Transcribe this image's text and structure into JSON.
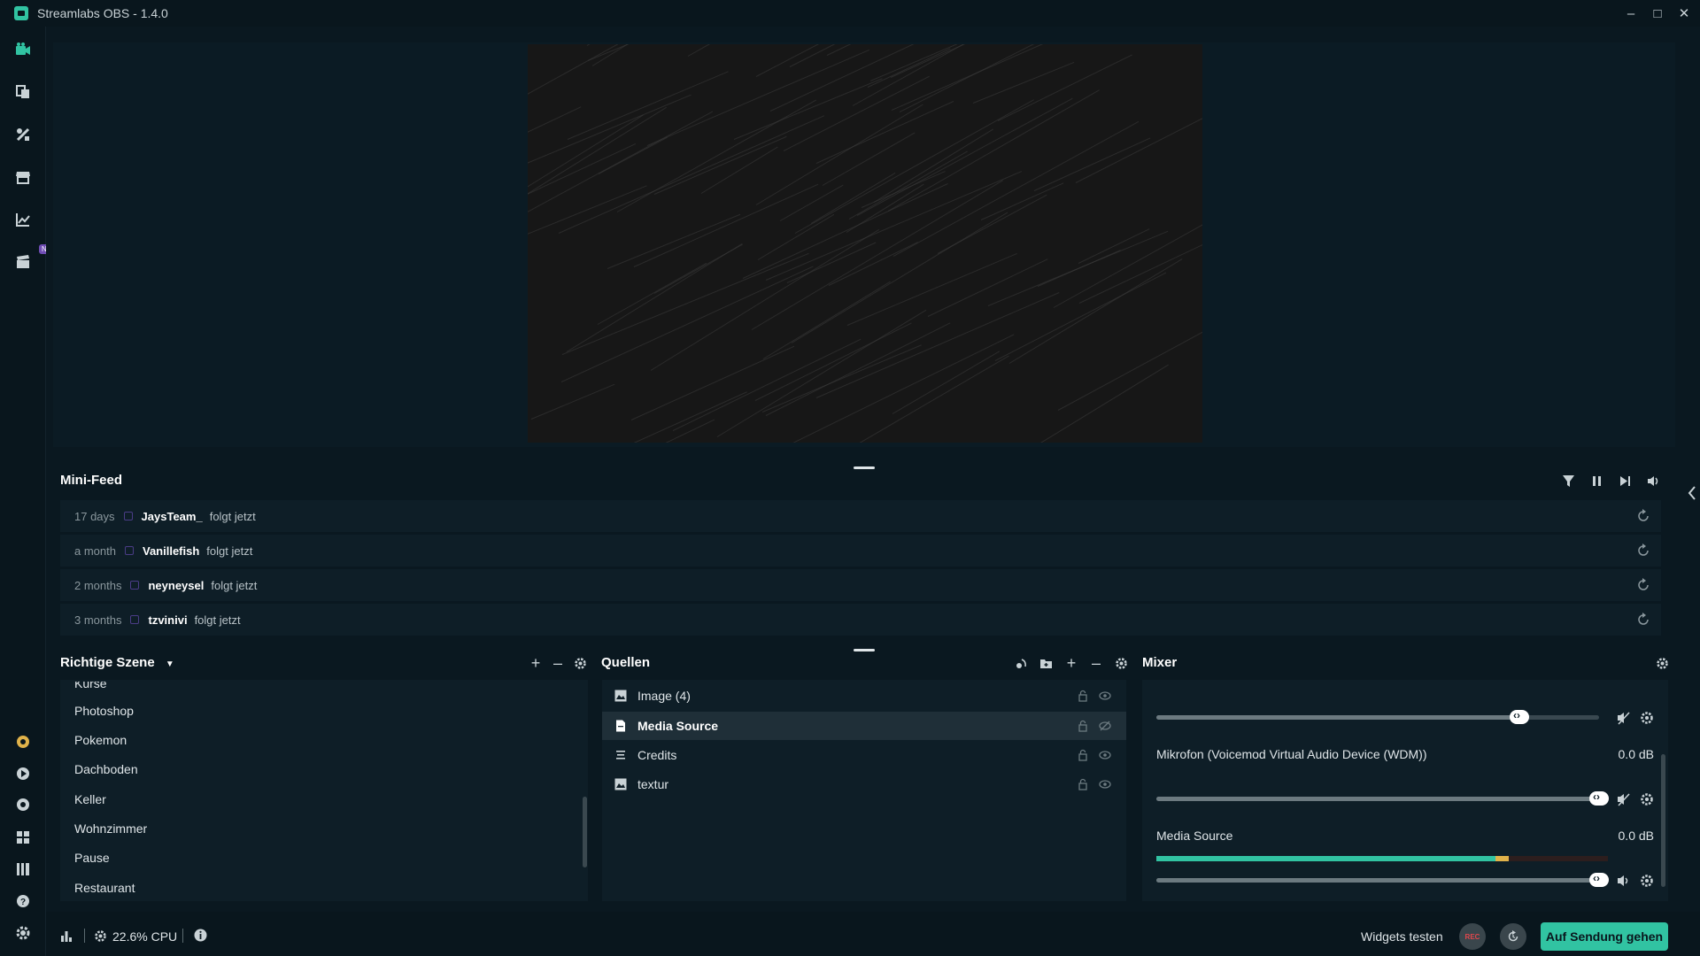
{
  "window": {
    "title": "Streamlabs OBS - 1.4.0"
  },
  "sidebar": {
    "new_badge": "Neu"
  },
  "minifeed": {
    "title": "Mini-Feed",
    "items": [
      {
        "time": "17 days",
        "user": "JaysTeam_",
        "action": "folgt jetzt"
      },
      {
        "time": "a month",
        "user": "Vanillefish",
        "action": "folgt jetzt"
      },
      {
        "time": "2 months",
        "user": "neyneysel",
        "action": "folgt jetzt"
      },
      {
        "time": "3 months",
        "user": "tzvinivi",
        "action": "folgt jetzt"
      }
    ]
  },
  "scenes": {
    "title": "Richtige Szene",
    "items": [
      "Kurse",
      "Photoshop",
      "Pokemon",
      "Dachboden",
      "Keller",
      "Wohnzimmer",
      "Pause",
      "Restaurant"
    ]
  },
  "sources": {
    "title": "Quellen",
    "items": [
      {
        "name": "Image (4)",
        "icon": "image-icon"
      },
      {
        "name": "Media Source",
        "icon": "file-icon"
      },
      {
        "name": "Credits",
        "icon": "list-icon"
      },
      {
        "name": "textur",
        "icon": "image-icon"
      }
    ]
  },
  "mixer": {
    "title": "Mixer",
    "channels": [
      {
        "name": "",
        "db": "",
        "volume": 0.82
      },
      {
        "name": "Mikrofon (Voicemod Virtual Audio Device (WDM))",
        "db": "0.0 dB",
        "volume": 1.0
      },
      {
        "name": "Media Source",
        "db": "0.0 dB",
        "volume": 1.0,
        "meter": 0.66
      }
    ]
  },
  "footer": {
    "cpu": "22.6% CPU",
    "test_widgets": "Widgets testen",
    "rec": "REC",
    "go_live": "Auf Sendung gehen"
  },
  "colors": {
    "accent": "#31c3a2",
    "background": "#09161d",
    "panel": "#0e1e27"
  }
}
